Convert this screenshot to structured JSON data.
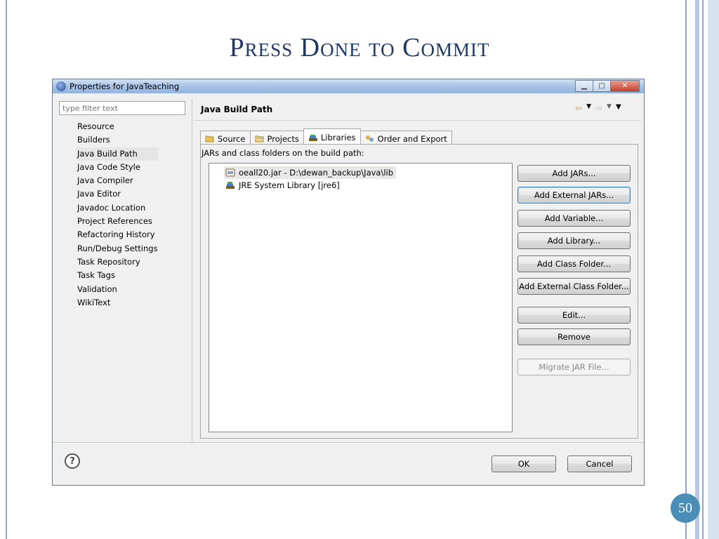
{
  "slide": {
    "title": "Press Done to Commit",
    "page_number": "50"
  },
  "window": {
    "title": "Properties for JavaTeaching",
    "controls": [
      "minimize-icon",
      "maximize-icon",
      "close-icon"
    ]
  },
  "filter": {
    "placeholder": "type filter text"
  },
  "nav": {
    "items": [
      "Resource",
      "Builders",
      "Java Build Path",
      "Java Code Style",
      "Java Compiler",
      "Java Editor",
      "Javadoc Location",
      "Project References",
      "Refactoring History",
      "Run/Debug Settings",
      "Task Repository",
      "Task Tags",
      "Validation",
      "WikiText"
    ],
    "selected": "Java Build Path"
  },
  "page": {
    "title": "Java Build Path"
  },
  "tabs": [
    {
      "label": "Source",
      "icon": "source-folder-icon"
    },
    {
      "label": "Projects",
      "icon": "projects-icon"
    },
    {
      "label": "Libraries",
      "icon": "libraries-icon",
      "active": true
    },
    {
      "label": "Order and Export",
      "icon": "order-export-icon"
    }
  ],
  "libraries": {
    "label": "JARs and class folders on the build path:",
    "entries": [
      {
        "text": "oeall20.jar - D:\\dewan_backup\\Java\\lib",
        "icon": "jar-icon",
        "selected": true
      },
      {
        "text": "JRE System Library [jre6]",
        "icon": "library-icon"
      }
    ]
  },
  "buttons": {
    "add_jars": "Add JARs...",
    "add_external_jars": "Add External JARs...",
    "add_variable": "Add Variable...",
    "add_library": "Add Library...",
    "add_class_folder": "Add Class Folder...",
    "add_external_class_folder": "Add External Class Folder...",
    "edit": "Edit...",
    "remove": "Remove",
    "migrate_jar": "Migrate JAR File..."
  },
  "footer": {
    "ok": "OK",
    "cancel": "Cancel"
  },
  "colors": {
    "title": "#1f3864",
    "page_badge": "#4a8db7",
    "titlebar": "#a8c3e6"
  }
}
